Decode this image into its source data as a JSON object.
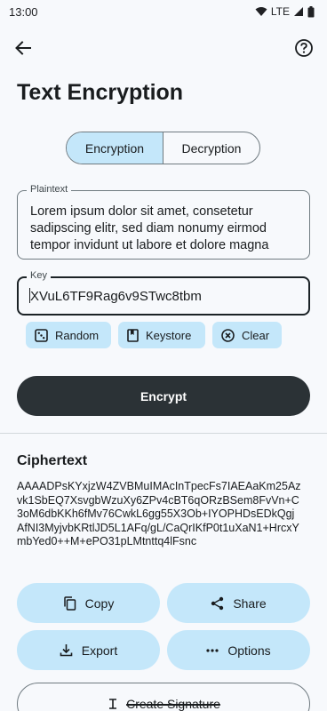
{
  "status_bar": {
    "time": "13:00",
    "network": "LTE"
  },
  "page": {
    "title": "Text Encryption"
  },
  "mode_tabs": [
    {
      "label": "Encryption",
      "active": true
    },
    {
      "label": "Decryption",
      "active": false
    }
  ],
  "plaintext": {
    "label": "Plaintext",
    "value": "Lorem ipsum dolor sit amet, consetetur sadipscing elitr, sed diam nonumy eirmod tempor invidunt ut labore et dolore magna"
  },
  "key": {
    "label": "Key",
    "value": "XVuL6TF9Rag6v9STwc8tbm"
  },
  "key_actions": {
    "random": "Random",
    "keystore": "Keystore",
    "clear": "Clear"
  },
  "encrypt_label": "Encrypt",
  "ciphertext": {
    "title": "Ciphertext",
    "value": "AAAADPsKYxjzW4ZVBMuIMAcInTpecFs7IAEAaKm25Azvk1SbEQ7XsvgbWzuXy6ZPv4cBT6qORzBSem8FvVn+C3oM6dbKKh6fMv76CwkL6gg55X3Ob+IYOPHDsEDkQgjAfNI3MyjvbKRtlJD5L1AFq/gL/CaQrIKfP0t1uXaN1+HrcxYmbYed0++M+ePO31pLMtnttq4lFsnc"
  },
  "actions": {
    "copy": "Copy",
    "share": "Share",
    "export": "Export",
    "options": "Options",
    "signature": "Create Signature"
  },
  "colors": {
    "tonal": "#c4e7fa",
    "primary_dark": "#2b3236",
    "background": "#f7f9fc"
  }
}
